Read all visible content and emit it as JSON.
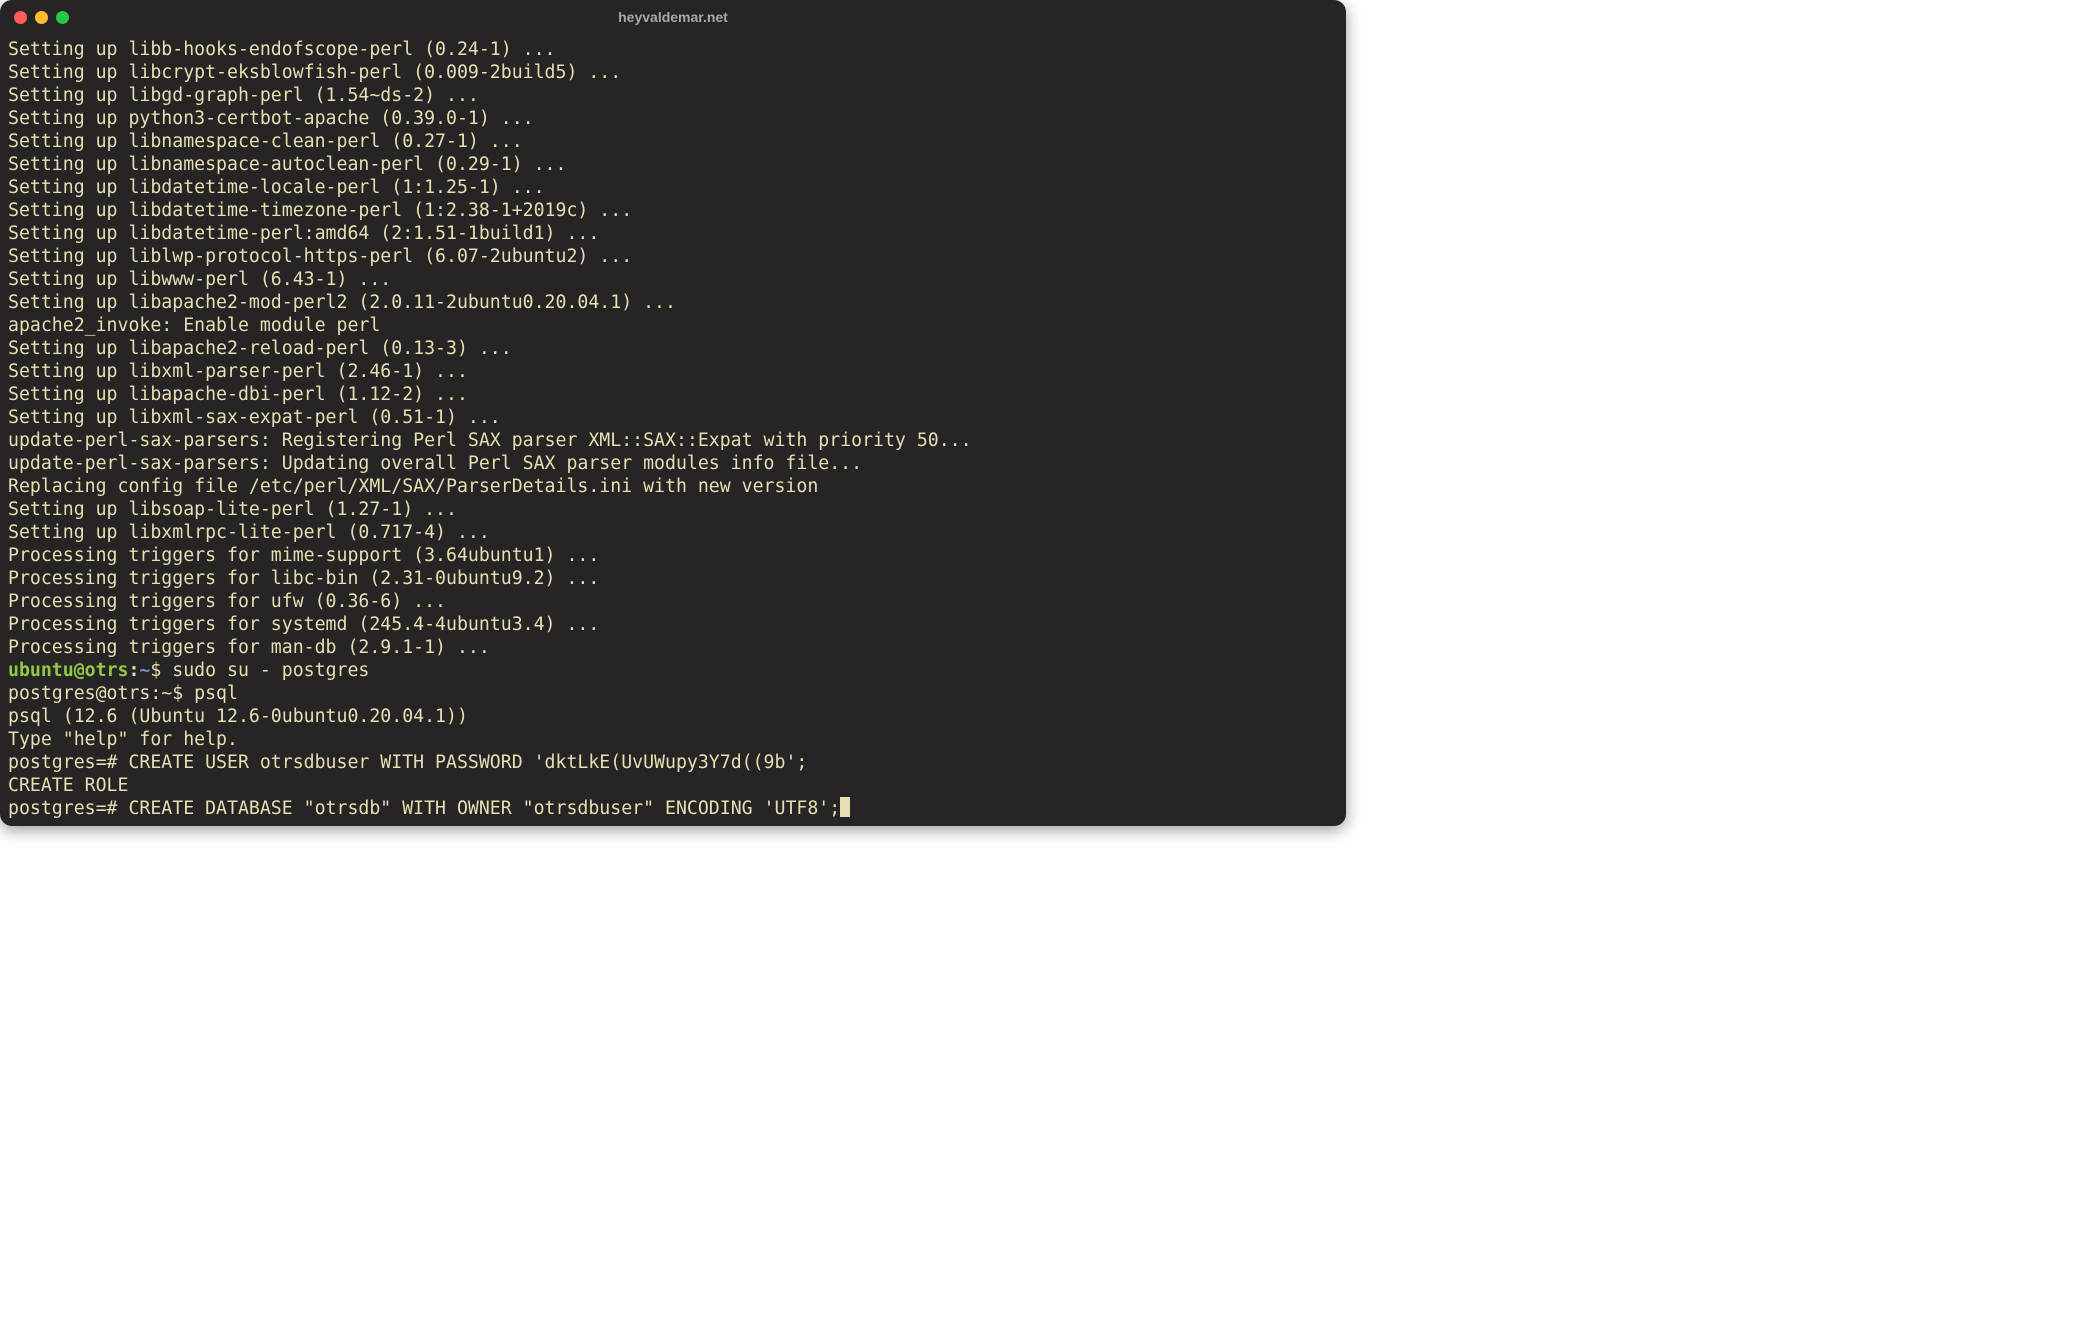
{
  "window": {
    "title": "heyvaldemar.net"
  },
  "prompt1": {
    "user": "ubuntu",
    "at": "@",
    "host": "otrs",
    "sep": ":",
    "path": "~",
    "symbol": "$ ",
    "command": "sudo su - postgres"
  },
  "prompt2": {
    "prefix": "postgres@otrs:~$ ",
    "command": "psql"
  },
  "psql_prompt1": {
    "prefix": "postgres=# ",
    "command": "CREATE USER otrsdbuser WITH PASSWORD 'dktLkE(UvUWupy3Y7d((9b';"
  },
  "psql_prompt2": {
    "prefix": "postgres=# ",
    "command": "CREATE DATABASE \"otrsdb\" WITH OWNER \"otrsdbuser\" ENCODING 'UTF8';"
  },
  "lines": {
    "l0": "Setting up libb-hooks-endofscope-perl (0.24-1) ...",
    "l1": "Setting up libcrypt-eksblowfish-perl (0.009-2build5) ...",
    "l2": "Setting up libgd-graph-perl (1.54~ds-2) ...",
    "l3": "Setting up python3-certbot-apache (0.39.0-1) ...",
    "l4": "Setting up libnamespace-clean-perl (0.27-1) ...",
    "l5": "Setting up libnamespace-autoclean-perl (0.29-1) ...",
    "l6": "Setting up libdatetime-locale-perl (1:1.25-1) ...",
    "l7": "Setting up libdatetime-timezone-perl (1:2.38-1+2019c) ...",
    "l8": "Setting up libdatetime-perl:amd64 (2:1.51-1build1) ...",
    "l9": "Setting up liblwp-protocol-https-perl (6.07-2ubuntu2) ...",
    "l10": "Setting up libwww-perl (6.43-1) ...",
    "l11": "Setting up libapache2-mod-perl2 (2.0.11-2ubuntu0.20.04.1) ...",
    "l12": "apache2_invoke: Enable module perl",
    "l13": "Setting up libapache2-reload-perl (0.13-3) ...",
    "l14": "Setting up libxml-parser-perl (2.46-1) ...",
    "l15": "Setting up libapache-dbi-perl (1.12-2) ...",
    "l16": "Setting up libxml-sax-expat-perl (0.51-1) ...",
    "l17": "update-perl-sax-parsers: Registering Perl SAX parser XML::SAX::Expat with priority 50...",
    "l18": "update-perl-sax-parsers: Updating overall Perl SAX parser modules info file...",
    "l19": "Replacing config file /etc/perl/XML/SAX/ParserDetails.ini with new version",
    "l20": "Setting up libsoap-lite-perl (1.27-1) ...",
    "l21": "Setting up libxmlrpc-lite-perl (0.717-4) ...",
    "l22": "Processing triggers for mime-support (3.64ubuntu1) ...",
    "l23": "Processing triggers for libc-bin (2.31-0ubuntu9.2) ...",
    "l24": "Processing triggers for ufw (0.36-6) ...",
    "l25": "Processing triggers for systemd (245.4-4ubuntu3.4) ...",
    "l26": "Processing triggers for man-db (2.9.1-1) ...",
    "l27": "psql (12.6 (Ubuntu 12.6-0ubuntu0.20.04.1))",
    "l28": "Type \"help\" for help.",
    "l29": "",
    "l30": "CREATE ROLE"
  }
}
